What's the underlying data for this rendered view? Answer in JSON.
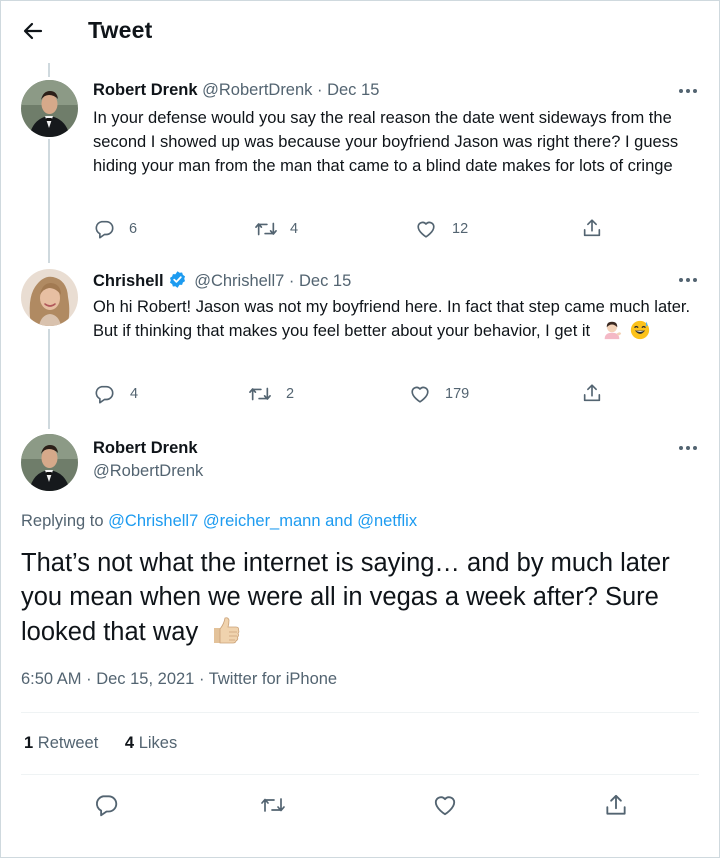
{
  "header": {
    "title": "Tweet"
  },
  "tweets": [
    {
      "name": "Robert Drenk",
      "handle": "@RobertDrenk",
      "date": "· Dec 15",
      "text": "In your defense would you say the real reason the date went sideways from the second I showed up was because your boyfriend Jason was right there? I guess hiding your man from the man that came to a blind date makes for lots of cringe",
      "replies": "6",
      "retweets": "4",
      "likes": "12"
    },
    {
      "name": "Chrishell",
      "handle": "@Chrishell7",
      "date": "· Dec 15",
      "verified": true,
      "text": "Oh hi Robert! Jason was not my boyfriend here. In fact that step came much later. But if thinking that makes you feel better about your behavior, I get it",
      "emoji": [
        "woman-tipping-hand-emoji",
        "grinning-sweat-emoji"
      ],
      "replies": "4",
      "retweets": "2",
      "likes": "179"
    }
  ],
  "main_tweet": {
    "name": "Robert Drenk",
    "handle": "@RobertDrenk",
    "replying_label": "Replying to",
    "mentions": [
      "@Chrishell7",
      "@reicher_mann",
      "@netflix"
    ],
    "and_label": "and",
    "text": "That’s not what the internet is saying… and by much later you mean when we were all in vegas a week after? Sure looked that way",
    "emoji": "thumbs-up-emoji",
    "timestamp": "6:50 AM · Dec 15, 2021 · Twitter for iPhone",
    "retweet_count": "1",
    "retweet_label": "Retweet",
    "like_count": "4",
    "like_label": "Likes"
  },
  "icons": {
    "back": "arrow-left-icon",
    "reply": "reply-icon",
    "retweet": "retweet-icon",
    "like": "heart-icon",
    "share": "share-icon",
    "more": "more-icon",
    "verified": "verified-badge-icon"
  },
  "colors": {
    "accent": "#1d9bf0",
    "text": "#0f1419",
    "secondary": "#536471",
    "border": "#cfd9de"
  }
}
